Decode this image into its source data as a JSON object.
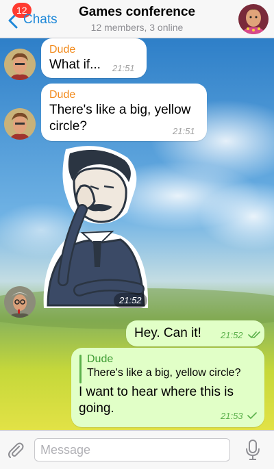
{
  "header": {
    "back_label": "Chats",
    "unread_count": "12",
    "title": "Games conference",
    "subtitle": "12 members, 3 online"
  },
  "messages": [
    {
      "sender": "Dude",
      "text": "What if...",
      "time": "21:51",
      "direction": "in"
    },
    {
      "sender": "Dude",
      "text_line1": "There's like a big, yellow",
      "text_line2": "circle?",
      "time": "21:51",
      "direction": "in"
    },
    {
      "type": "sticker",
      "time": "21:52",
      "direction": "in"
    },
    {
      "text": "Hey. Can it!",
      "time": "21:52",
      "direction": "out",
      "status": "read"
    },
    {
      "reply_sender": "Dude",
      "reply_text": "There's like a big, yellow circle?",
      "text_line1": "I want to hear where this is",
      "text_line2": "going.",
      "time": "21:53",
      "direction": "out",
      "status": "delivered"
    }
  ],
  "composer": {
    "placeholder": "Message"
  },
  "colors": {
    "accent": "#1e88d8",
    "sender_name": "#f28a1b",
    "outgoing_bubble": "#e1ffc7",
    "badge": "#ff3b30"
  },
  "icons": [
    "back-chevron-icon",
    "paperclip-icon",
    "microphone-icon",
    "double-check-icon",
    "check-icon"
  ]
}
